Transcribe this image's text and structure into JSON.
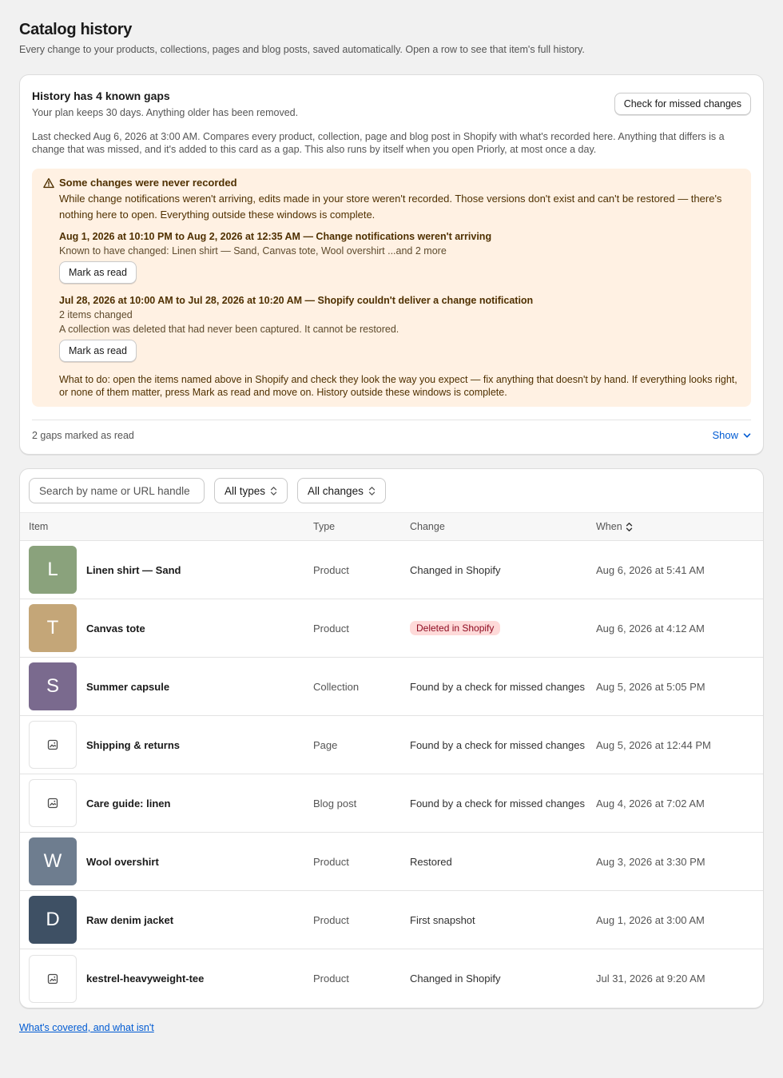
{
  "header": {
    "title": "Catalog history",
    "subtitle": "Every change to your products, collections, pages and blog posts, saved automatically. Open a row to see that item's full history."
  },
  "gaps": {
    "title": "History has 4 known gaps",
    "plan": "Your plan keeps 30 days. Anything older has been removed.",
    "check_button": "Check for missed changes",
    "description": "Last checked Aug 6, 2026 at 3:00 AM. Compares every product, collection, page and blog post in Shopify with what's recorded here. Anything that differs is a change that was missed, and it's added to this card as a gap. This also runs by itself when you open Priorly, at most once a day.",
    "warning": {
      "title": "Some changes were never recorded",
      "text": "While change notifications weren't arriving, edits made in your store weren't recorded. Those versions don't exist and can't be restored — there's nothing here to open. Everything outside these windows is complete.",
      "windows": [
        {
          "title": "Aug 1, 2026 at 10:10 PM to Aug 2, 2026 at 12:35 AM — Change notifications weren't arriving",
          "lines": [
            "Known to have changed: Linen shirt — Sand, Canvas tote, Wool overshirt ...and 2 more"
          ],
          "button": "Mark as read"
        },
        {
          "title": "Jul 28, 2026 at 10:00 AM to Jul 28, 2026 at 10:20 AM — Shopify couldn't deliver a change notification",
          "lines": [
            "2 items changed",
            "A collection was deleted that had never been captured. It cannot be restored."
          ],
          "button": "Mark as read"
        }
      ],
      "todo": "What to do: open the items named above in Shopify and check they look the way you expect — fix anything that doesn't by hand. If everything looks right, or none of them matter, press Mark as read and move on. History outside these windows is complete."
    },
    "marked": "2 gaps marked as read",
    "show_label": "Show"
  },
  "filters": {
    "search_placeholder": "Search by name or URL handle",
    "type_select": "All types",
    "change_select": "All changes"
  },
  "table": {
    "headers": {
      "item": "Item",
      "type": "Type",
      "change": "Change",
      "when": "When"
    },
    "rows": [
      {
        "initial": "L",
        "color": "#8aa27c",
        "name": "Linen shirt — Sand",
        "type": "Product",
        "change": "Changed in Shopify",
        "badge": false,
        "when": "Aug 6, 2026 at 5:41 AM"
      },
      {
        "initial": "T",
        "color": "#c4a678",
        "name": "Canvas tote",
        "type": "Product",
        "change": "Deleted in Shopify",
        "badge": true,
        "when": "Aug 6, 2026 at 4:12 AM"
      },
      {
        "initial": "S",
        "color": "#7a6a8e",
        "name": "Summer capsule",
        "type": "Collection",
        "change": "Found by a check for missed changes",
        "badge": false,
        "when": "Aug 5, 2026 at 5:05 PM"
      },
      {
        "initial": "",
        "color": "",
        "name": "Shipping & returns",
        "type": "Page",
        "change": "Found by a check for missed changes",
        "badge": false,
        "when": "Aug 5, 2026 at 12:44 PM"
      },
      {
        "initial": "",
        "color": "",
        "name": "Care guide: linen",
        "type": "Blog post",
        "change": "Found by a check for missed changes",
        "badge": false,
        "when": "Aug 4, 2026 at 7:02 AM"
      },
      {
        "initial": "W",
        "color": "#6e7d8f",
        "name": "Wool overshirt",
        "type": "Product",
        "change": "Restored",
        "badge": false,
        "when": "Aug 3, 2026 at 3:30 PM"
      },
      {
        "initial": "D",
        "color": "#3e5064",
        "name": "Raw denim jacket",
        "type": "Product",
        "change": "First snapshot",
        "badge": false,
        "when": "Aug 1, 2026 at 3:00 AM"
      },
      {
        "initial": "",
        "color": "",
        "name": "kestrel-heavyweight-tee",
        "type": "Product",
        "change": "Changed in Shopify",
        "badge": false,
        "when": "Jul 31, 2026 at 9:20 AM"
      }
    ]
  },
  "footer": {
    "link": "What's covered, and what isn't"
  }
}
